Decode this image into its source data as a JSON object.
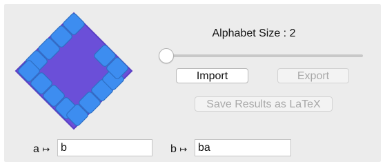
{
  "alphabet": {
    "label": "Alphabet Size :",
    "value": "2",
    "slider_fraction": 0
  },
  "buttons": {
    "import_label": "Import",
    "export_label": "Export",
    "save_latex_label": "Save Results as LaTeX"
  },
  "mappings": [
    {
      "symbol": "a",
      "arrow": "↦",
      "value": "b"
    },
    {
      "symbol": "b",
      "arrow": "↦",
      "value": "ba"
    }
  ],
  "colors": {
    "diamond": "#6b4fd8",
    "tile": "#3d8df0",
    "window_bg": "#ececec"
  }
}
